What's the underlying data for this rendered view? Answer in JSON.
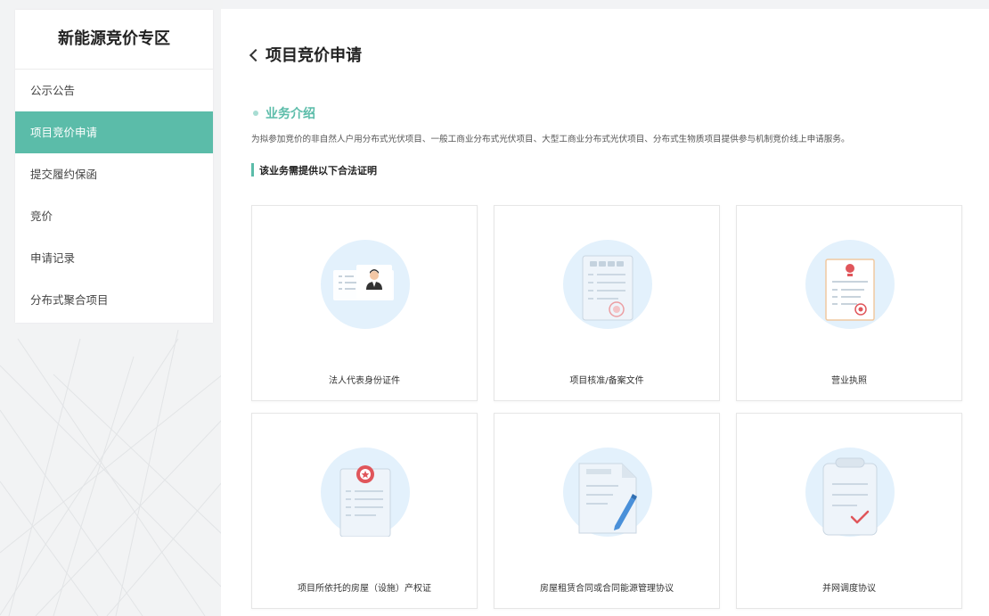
{
  "sidebar": {
    "title": "新能源竞价专区",
    "items": [
      {
        "label": "公示公告"
      },
      {
        "label": "项目竞价申请"
      },
      {
        "label": "提交履约保函"
      },
      {
        "label": "竞价"
      },
      {
        "label": "申请记录"
      },
      {
        "label": "分布式聚合项目"
      }
    ],
    "active_index": 1
  },
  "main": {
    "title": "项目竞价申请",
    "section_title": "业务介绍",
    "intro": "为拟参加竞价的非自然人户用分布式光伏项目、一般工商业分布式光伏项目、大型工商业分布式光伏项目、分布式生物质项目提供参与机制竞价线上申请服务。",
    "requirements_title": "该业务需提供以下合法证明",
    "cards": [
      {
        "label": "法人代表身份证件",
        "icon": "id-card-icon"
      },
      {
        "label": "项目核准/备案文件",
        "icon": "approval-document-icon"
      },
      {
        "label": "营业执照",
        "icon": "business-license-icon"
      },
      {
        "label": "项目所依托的房屋（设施）产权证",
        "icon": "property-certificate-icon"
      },
      {
        "label": "房屋租赁合同或合同能源管理协议",
        "icon": "contract-pen-icon"
      },
      {
        "label": "并网调度协议",
        "icon": "clipboard-check-icon"
      }
    ]
  },
  "colors": {
    "accent": "#5bbca9",
    "icon_circle": "#e3f1fc",
    "stamp_red": "#e0565b"
  }
}
